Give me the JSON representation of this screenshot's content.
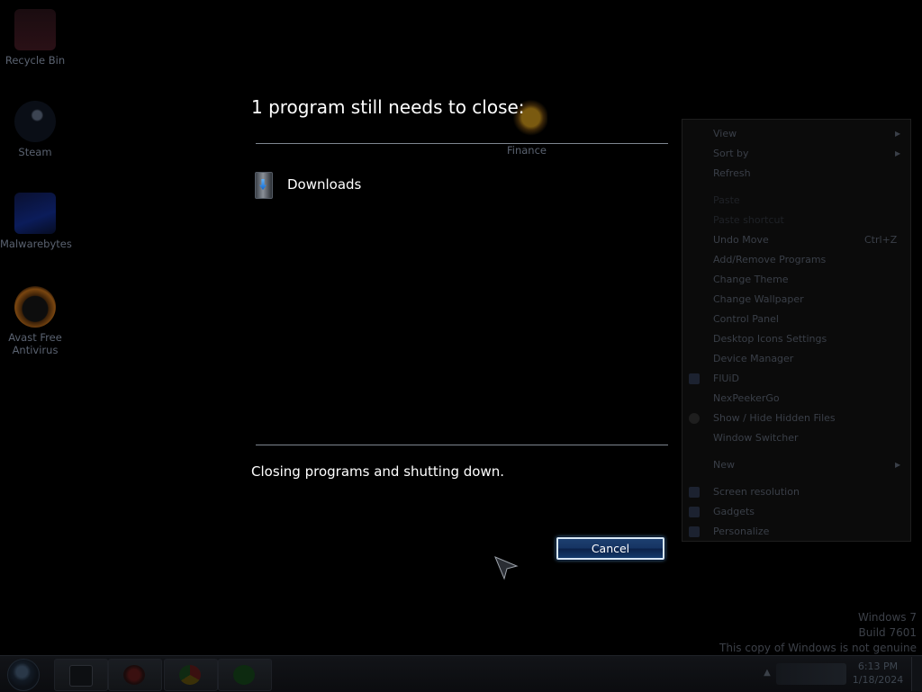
{
  "desktop": {
    "icons": [
      {
        "label": "Recycle Bin"
      },
      {
        "label": "Steam"
      },
      {
        "label": "Malwarebytes"
      },
      {
        "label": "Avast Free Antivirus"
      },
      {
        "label": "Finance"
      }
    ]
  },
  "shutdown": {
    "title": "1 program still needs to close:",
    "program_name": "Downloads",
    "status": "Closing programs and shutting down.",
    "cancel_label": "Cancel"
  },
  "context_menu": {
    "items": [
      {
        "label": "View",
        "submenu": "▶"
      },
      {
        "label": "Sort by",
        "submenu": "▶"
      },
      {
        "label": "Refresh"
      },
      {
        "label": "Paste"
      },
      {
        "label": "Paste shortcut"
      },
      {
        "label": "Undo Move",
        "shortcut": "Ctrl+Z"
      },
      {
        "label": "Add/Remove Programs"
      },
      {
        "label": "Change Theme"
      },
      {
        "label": "Change Wallpaper"
      },
      {
        "label": "Control Panel"
      },
      {
        "label": "Desktop Icons Settings"
      },
      {
        "label": "Device Manager"
      },
      {
        "label": "FlUiD"
      },
      {
        "label": "NexPeekerGo"
      },
      {
        "label": "Show / Hide Hidden Files"
      },
      {
        "label": "Window Switcher"
      },
      {
        "label": "New",
        "submenu": "▶"
      },
      {
        "label": "Screen resolution"
      },
      {
        "label": "Gadgets"
      },
      {
        "label": "Personalize"
      }
    ]
  },
  "watermark": {
    "line1": "Windows 7",
    "line2": "Build 7601",
    "line3": "This copy of Windows is not genuine"
  },
  "taskbar": {
    "clock_time": "6:13 PM",
    "clock_date": "1/18/2024",
    "tray_expand_glyph": "▲"
  },
  "colors": {
    "background": "#000000",
    "divider": "#7e8690",
    "cancel_button_fill": "#163463",
    "cancel_button_border": "#d8e8f5"
  }
}
